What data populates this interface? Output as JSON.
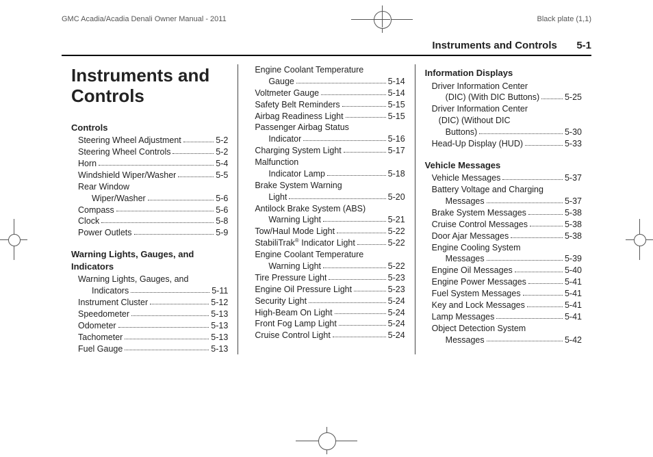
{
  "header": {
    "doc_title": "GMC Acadia/Acadia Denali Owner Manual - 2011",
    "plate": "Black plate (1,1)"
  },
  "running_head": {
    "title": "Instruments and Controls",
    "page": "5-1"
  },
  "chapter_title": "Instruments and Controls",
  "col1_sections": [
    {
      "heading": "Controls",
      "entries": [
        {
          "label": "Steering Wheel Adjustment",
          "page": "5-2"
        },
        {
          "label": "Steering Wheel Controls",
          "page": "5-2"
        },
        {
          "label": "Horn",
          "page": "5-4"
        },
        {
          "label": "Windshield Wiper/Washer",
          "page": "5-5"
        },
        {
          "wrap": true,
          "line1": "Rear Window",
          "label": "Wiper/Washer",
          "page": "5-6"
        },
        {
          "label": "Compass",
          "page": "5-6"
        },
        {
          "label": "Clock",
          "page": "5-8"
        },
        {
          "label": "Power Outlets",
          "page": "5-9"
        }
      ]
    },
    {
      "heading": "Warning Lights, Gauges, and Indicators",
      "entries": [
        {
          "wrap": true,
          "line1": "Warning Lights, Gauges, and",
          "label": "Indicators",
          "page": "5-11"
        },
        {
          "label": "Instrument Cluster",
          "page": "5-12"
        },
        {
          "label": "Speedometer",
          "page": "5-13"
        },
        {
          "label": "Odometer",
          "page": "5-13"
        },
        {
          "label": "Tachometer",
          "page": "5-13"
        },
        {
          "label": "Fuel Gauge",
          "page": "5-13"
        }
      ]
    }
  ],
  "col2_entries": [
    {
      "wrap": true,
      "line1": "Engine Coolant Temperature",
      "label": "Gauge",
      "page": "5-14"
    },
    {
      "label": "Voltmeter Gauge",
      "page": "5-14"
    },
    {
      "label": "Safety Belt Reminders",
      "page": "5-15"
    },
    {
      "label": "Airbag Readiness Light",
      "page": "5-15"
    },
    {
      "wrap": true,
      "line1": "Passenger Airbag Status",
      "label": "Indicator",
      "page": "5-16"
    },
    {
      "label": "Charging System Light",
      "page": "5-17"
    },
    {
      "wrap": true,
      "line1": "Malfunction",
      "label": "Indicator Lamp",
      "page": "5-18"
    },
    {
      "wrap": true,
      "line1": "Brake System Warning",
      "label": "Light",
      "page": "5-20"
    },
    {
      "wrap": true,
      "line1": "Antilock Brake System (ABS)",
      "label": "Warning Light",
      "page": "5-21"
    },
    {
      "label": "Tow/Haul Mode Light",
      "page": "5-22"
    },
    {
      "label_html": "StabiliTrak<sup>®</sup> Indicator Light",
      "page": "5-22"
    },
    {
      "wrap": true,
      "line1": "Engine Coolant Temperature",
      "label": "Warning Light",
      "page": "5-22"
    },
    {
      "label": "Tire Pressure Light",
      "page": "5-23"
    },
    {
      "label": "Engine Oil Pressure Light",
      "page": "5-23"
    },
    {
      "label": "Security Light",
      "page": "5-24"
    },
    {
      "label": "High-Beam On Light",
      "page": "5-24"
    },
    {
      "label": "Front Fog Lamp Light",
      "page": "5-24"
    },
    {
      "label": "Cruise Control Light",
      "page": "5-24"
    }
  ],
  "col3_sections": [
    {
      "heading": "Information Displays",
      "entries": [
        {
          "wrap": true,
          "line1": "Driver Information Center",
          "label": "(DIC) (With DIC Buttons)",
          "page": "5-25"
        },
        {
          "wrap3": true,
          "line1": "Driver Information Center",
          "line2": "(DIC) (Without DIC",
          "label": "Buttons)",
          "page": "5-30"
        },
        {
          "label": "Head-Up Display (HUD)",
          "page": "5-33"
        }
      ]
    },
    {
      "heading": "Vehicle Messages",
      "entries": [
        {
          "label": "Vehicle Messages",
          "page": "5-37"
        },
        {
          "wrap": true,
          "line1": "Battery Voltage and Charging",
          "label": "Messages",
          "page": "5-37"
        },
        {
          "label": "Brake System Messages",
          "page": "5-38"
        },
        {
          "label": "Cruise Control Messages",
          "page": "5-38"
        },
        {
          "label": "Door Ajar Messages",
          "page": "5-38"
        },
        {
          "wrap": true,
          "line1": "Engine Cooling System",
          "label": "Messages",
          "page": "5-39"
        },
        {
          "label": "Engine Oil Messages",
          "page": "5-40"
        },
        {
          "label": "Engine Power Messages",
          "page": "5-41"
        },
        {
          "label": "Fuel System Messages",
          "page": "5-41"
        },
        {
          "label": "Key and Lock Messages",
          "page": "5-41"
        },
        {
          "label": "Lamp Messages",
          "page": "5-41"
        },
        {
          "wrap": true,
          "line1": "Object Detection System",
          "label": "Messages",
          "page": "5-42"
        }
      ]
    }
  ]
}
